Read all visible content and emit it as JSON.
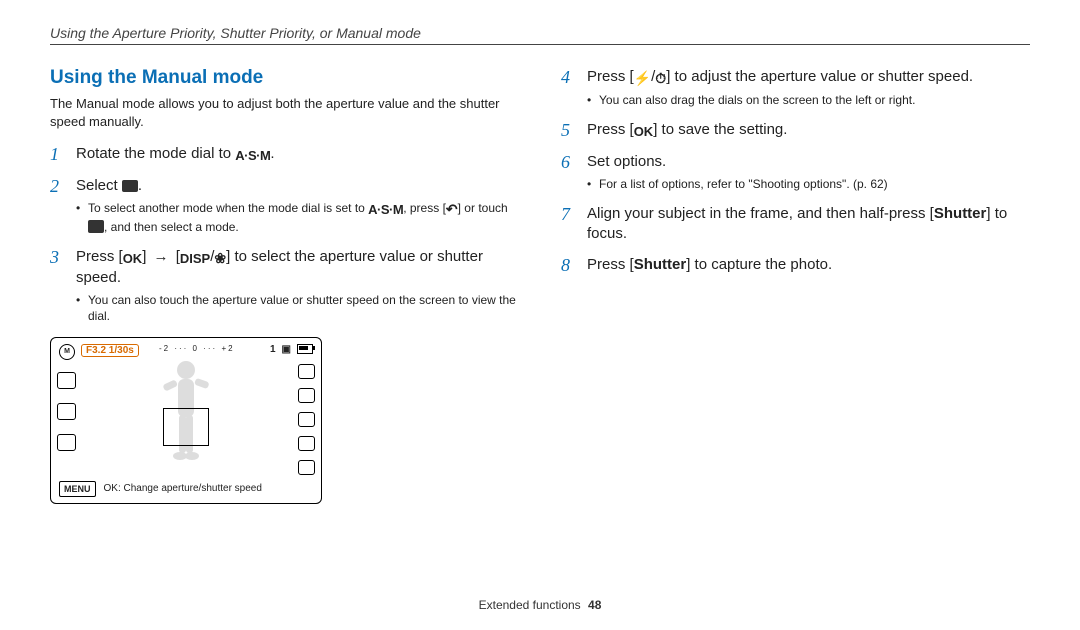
{
  "header": "Using the Aperture Priority, Shutter Priority, or Manual mode",
  "section_title": "Using the Manual mode",
  "intro": "The Manual mode allows you to adjust both the aperture value and the shutter speed manually.",
  "steps": {
    "s1": {
      "n": "1",
      "pre": "Rotate the mode dial to ",
      "post": "."
    },
    "s2": {
      "n": "2",
      "pre": "Select ",
      "post": ".",
      "sub_a_pre": "To select another mode when the mode dial is set to ",
      "sub_a_mid": ", press [",
      "sub_a_mid2": "] or touch ",
      "sub_a_post": ", and then select a mode."
    },
    "s3": {
      "n": "3",
      "pre": "Press [",
      "mid1": "] ",
      "mid2": " [",
      "mid3": "/",
      "post": "] to select the aperture value or shutter speed.",
      "sub": "You can also touch the aperture value or shutter speed on the screen to view the dial."
    },
    "s4": {
      "n": "4",
      "pre": "Press [",
      "mid": "/",
      "post": "] to adjust the aperture value or shutter speed.",
      "sub": "You can also drag the dials on the screen to the left or right."
    },
    "s5": {
      "n": "5",
      "pre": "Press [",
      "post": "] to save the setting."
    },
    "s6": {
      "n": "6",
      "text": "Set options.",
      "sub": "For a list of options, refer to \"Shooting options\". (p. 62)"
    },
    "s7": {
      "n": "7",
      "pre": "Align your subject in the frame, and then half-press [",
      "btn": "Shutter",
      "post": "] to focus."
    },
    "s8": {
      "n": "8",
      "pre": "Press [",
      "btn": "Shutter",
      "post": "] to capture the photo."
    }
  },
  "glyphs": {
    "asm": "A·S·M",
    "ok": "OK",
    "disp": "DISP",
    "arrow": "→",
    "bolt": "⚡",
    "timer": "⏱",
    "macro": "❀",
    "back": "↶"
  },
  "shot": {
    "label_asm": "M",
    "readout": "F3.2 1/30s",
    "expo": "-2 ··· 0 ··· +2",
    "count": "1",
    "sd": "▣",
    "menu": "MENU",
    "bottom": "OK: Change aperture/shutter speed"
  },
  "footer": {
    "section": "Extended functions",
    "page": "48"
  }
}
